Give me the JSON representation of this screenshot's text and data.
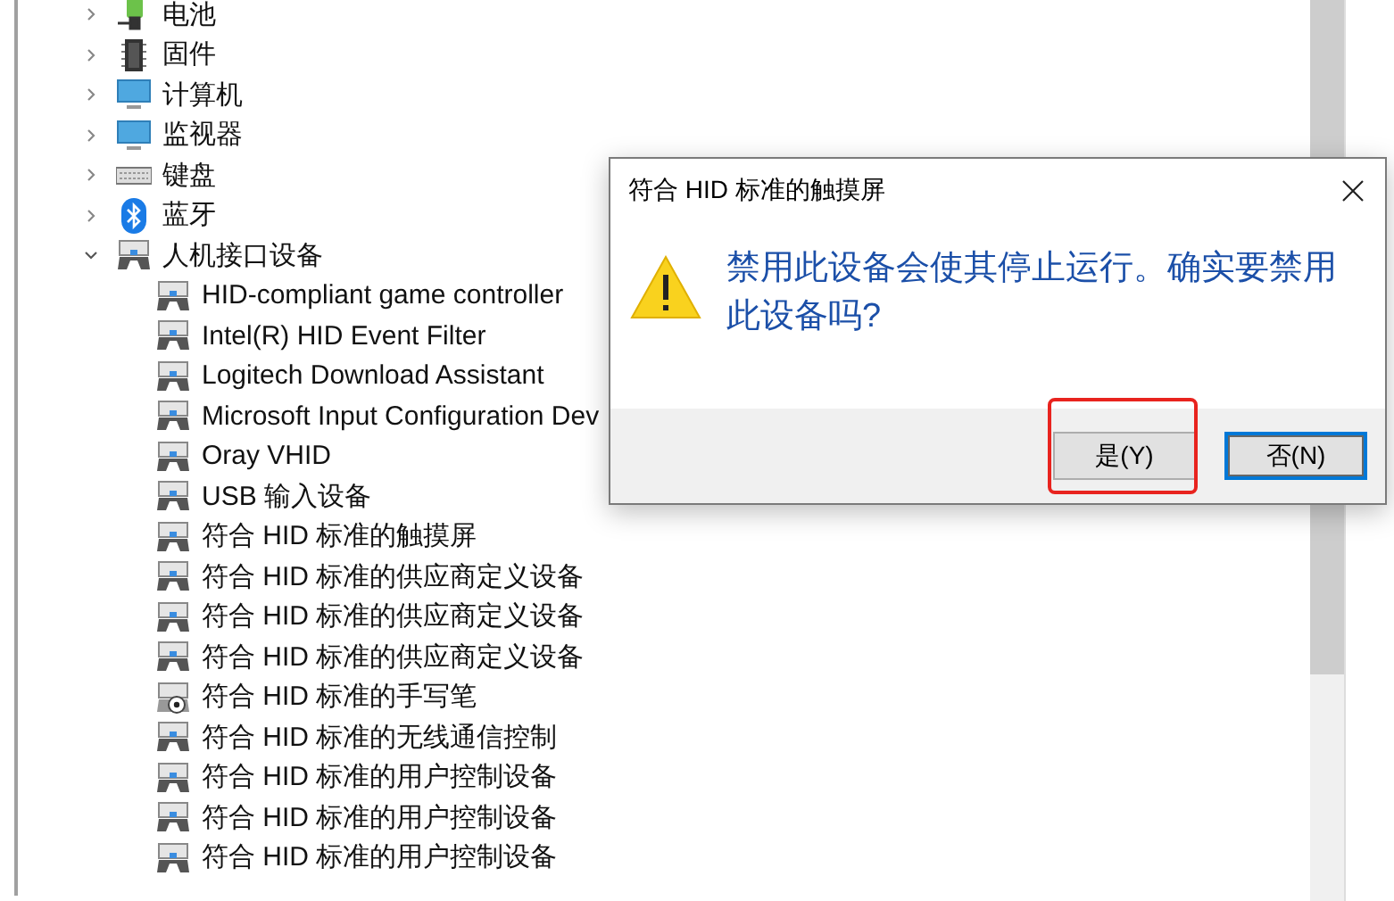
{
  "tree": {
    "items": [
      {
        "label": "电池",
        "kind": "battery",
        "expanded": false
      },
      {
        "label": "固件",
        "kind": "chip",
        "expanded": false
      },
      {
        "label": "计算机",
        "kind": "computer",
        "expanded": false
      },
      {
        "label": "监视器",
        "kind": "monitor",
        "expanded": false
      },
      {
        "label": "键盘",
        "kind": "keyboard",
        "expanded": false
      },
      {
        "label": "蓝牙",
        "kind": "bluetooth",
        "expanded": false
      },
      {
        "label": "人机接口设备",
        "kind": "hid",
        "expanded": true,
        "children": [
          {
            "label": "HID-compliant game controller",
            "kind": "hid"
          },
          {
            "label": "Intel(R) HID Event Filter",
            "kind": "hid"
          },
          {
            "label": "Logitech Download Assistant",
            "kind": "hid"
          },
          {
            "label": "Microsoft Input Configuration Dev",
            "kind": "hid"
          },
          {
            "label": "Oray VHID",
            "kind": "hid"
          },
          {
            "label": "USB 输入设备",
            "kind": "hid"
          },
          {
            "label": "符合 HID 标准的触摸屏",
            "kind": "hid"
          },
          {
            "label": "符合 HID 标准的供应商定义设备",
            "kind": "hid"
          },
          {
            "label": "符合 HID 标准的供应商定义设备",
            "kind": "hid"
          },
          {
            "label": "符合 HID 标准的供应商定义设备",
            "kind": "hid"
          },
          {
            "label": "符合 HID 标准的手写笔",
            "kind": "pen"
          },
          {
            "label": "符合 HID 标准的无线通信控制",
            "kind": "hid"
          },
          {
            "label": "符合 HID 标准的用户控制设备",
            "kind": "hid"
          },
          {
            "label": "符合 HID 标准的用户控制设备",
            "kind": "hid"
          },
          {
            "label": "符合 HID 标准的用户控制设备",
            "kind": "hid"
          }
        ]
      }
    ]
  },
  "dialog": {
    "title": "符合 HID 标准的触摸屏",
    "message": "禁用此设备会使其停止运行。确实要禁用此设备吗?",
    "buttons": [
      {
        "label": "是(Y)",
        "focused": false,
        "highlighted": true
      },
      {
        "label": "否(N)",
        "focused": true,
        "highlighted": false
      }
    ]
  }
}
